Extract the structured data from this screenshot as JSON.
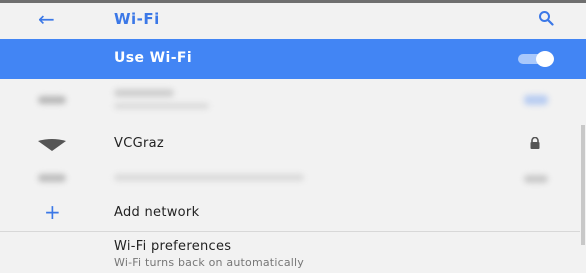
{
  "appbar": {
    "back_icon": "arrow-left-icon",
    "title": "Wi-Fi",
    "search_icon": "search-icon"
  },
  "toggle": {
    "label": "Use Wi-Fi",
    "state": "on",
    "accent_color": "#4285f4"
  },
  "networks": [
    {
      "name": "VCGraz",
      "icon": "wifi-signal-icon",
      "secured": true,
      "lock_icon": "lock-icon"
    }
  ],
  "add_network": {
    "icon": "plus-icon",
    "label": "Add network"
  },
  "preferences": {
    "title": "Wi-Fi preferences",
    "subtitle": "Wi-Fi turns back on automatically"
  }
}
